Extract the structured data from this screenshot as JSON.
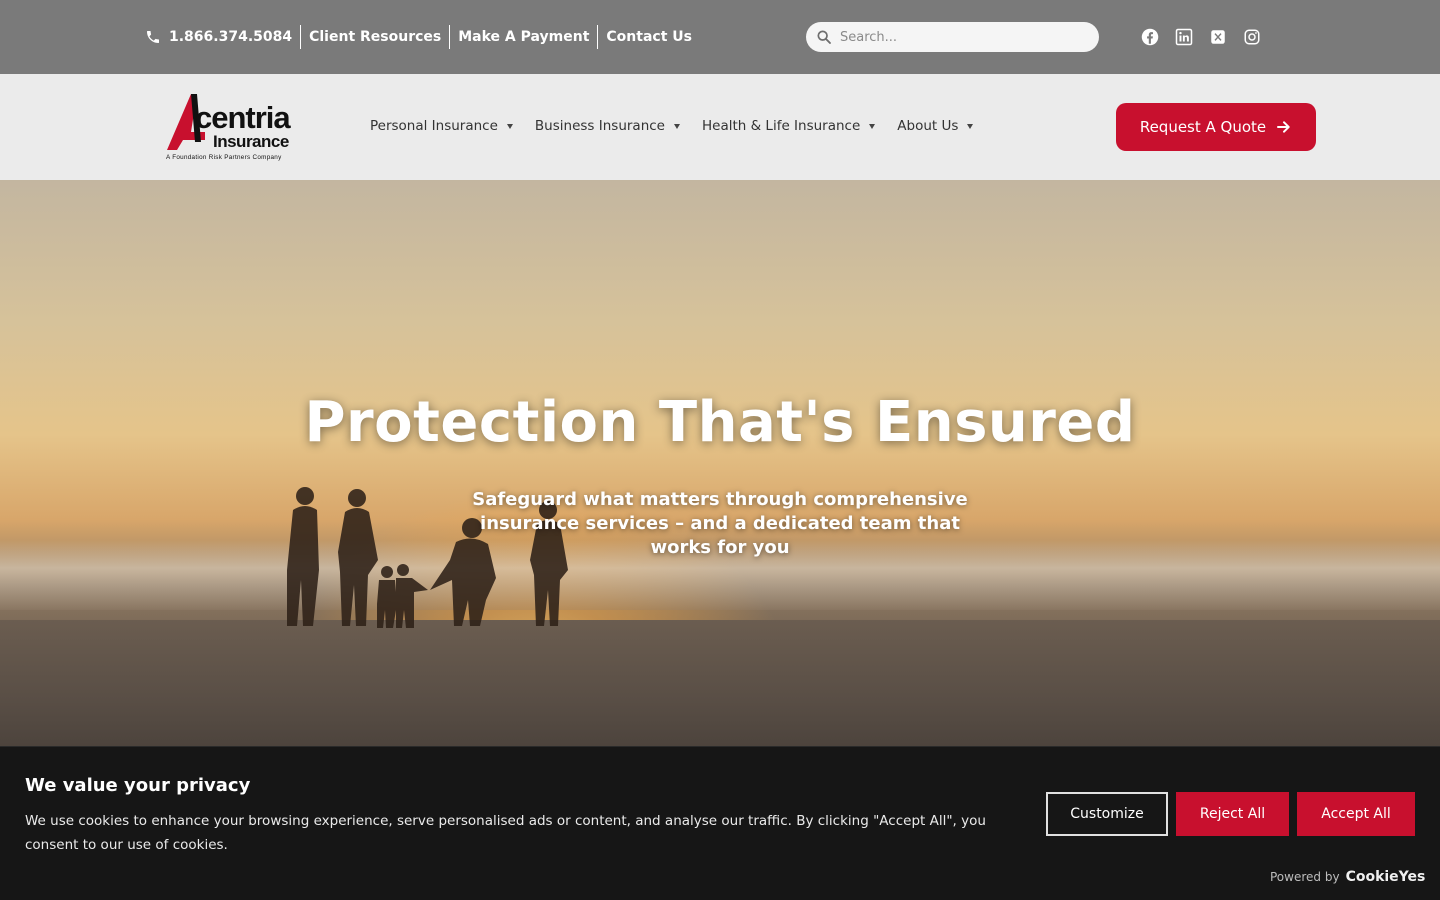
{
  "topbar": {
    "phone": "1.866.374.5084",
    "links": [
      "Client Resources",
      "Make A Payment",
      "Contact Us"
    ],
    "search_placeholder": "Search...",
    "social_icons": [
      "facebook-icon",
      "linkedin-icon",
      "x-twitter-icon",
      "instagram-icon"
    ]
  },
  "logo": {
    "line1": "centria",
    "line2": "Insurance",
    "tagline": "A Foundation Risk Partners Company"
  },
  "nav": {
    "items": [
      "Personal Insurance",
      "Business Insurance",
      "Health & Life Insurance",
      "About Us"
    ],
    "cta_label": "Request A Quote"
  },
  "hero": {
    "title": "Protection That's Ensured",
    "subtitle": "Safeguard what matters through comprehensive insurance services – and a dedicated team that works for you"
  },
  "cookie_banner": {
    "title": "We value your privacy",
    "message": "We use cookies to enhance your browsing experience, serve personalised ads or content, and analyse our traffic. By clicking \"Accept All\", you consent to our use of cookies.",
    "customize_label": "Customize",
    "reject_label": "Reject All",
    "accept_label": "Accept All",
    "powered_by": "Powered by",
    "powered_brand": "CookieYes"
  },
  "colors": {
    "brand_red": "#c8102e",
    "topbar_bg": "#7a7a7a",
    "nav_bg": "#ebebeb",
    "banner_bg": "#161616"
  }
}
